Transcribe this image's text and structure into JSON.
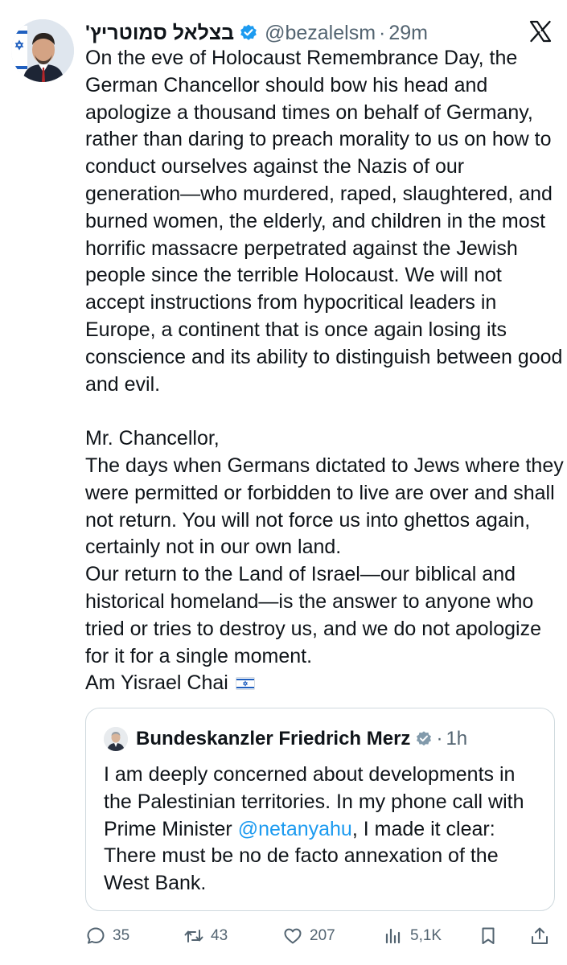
{
  "author": {
    "name": "בצלאל סמוטריץ'",
    "handle": "@bezalelsm",
    "separator": "·",
    "time": "29m",
    "verified_color": "#1d9bf0"
  },
  "tweet": {
    "paragraphs": [
      "On the eve of Holocaust Remembrance Day, the German Chancellor should bow his head and apologize a thousand times on behalf of Germany, rather than daring to preach morality to us on how to conduct ourselves against the Nazis of our generation—who murdered, raped, slaughtered, and burned women, the elderly, and children in the most horrific massacre perpetrated against the Jewish people since the terrible Holocaust. We will not accept instructions from hypocritical leaders in Europe, a continent that is once again losing its conscience and its ability to distinguish between good and evil.",
      "Mr. Chancellor,\nThe days when Germans dictated to Jews where they were permitted or forbidden to live are over and shall not return. You will not force us into ghettos again, certainly not in our own land.\nOur return to the Land of Israel—our biblical and historical homeland—is the answer to anyone who tried or tries to destroy us, and we do not apologize for it for a single moment.\nAm Yisrael Chai"
    ],
    "flag_icon": "israel-flag-icon"
  },
  "quote": {
    "name": "Bundeskanzler Friedrich Merz",
    "separator": "·",
    "time": "1h",
    "text_before": "I am deeply concerned about developments in the Palestinian territories. In my phone call with Prime Minister ",
    "mention": "@netanyahu",
    "text_after": ", I made it clear: There must be no de facto annexation of the West Bank.",
    "verified_color": "#829aab"
  },
  "actions": {
    "replies": "35",
    "reposts": "43",
    "likes": "207",
    "views": "5,1K"
  },
  "colors": {
    "text": "#0f1419",
    "secondary": "#536471",
    "link": "#1d9bf0",
    "border": "#cfd9de"
  }
}
